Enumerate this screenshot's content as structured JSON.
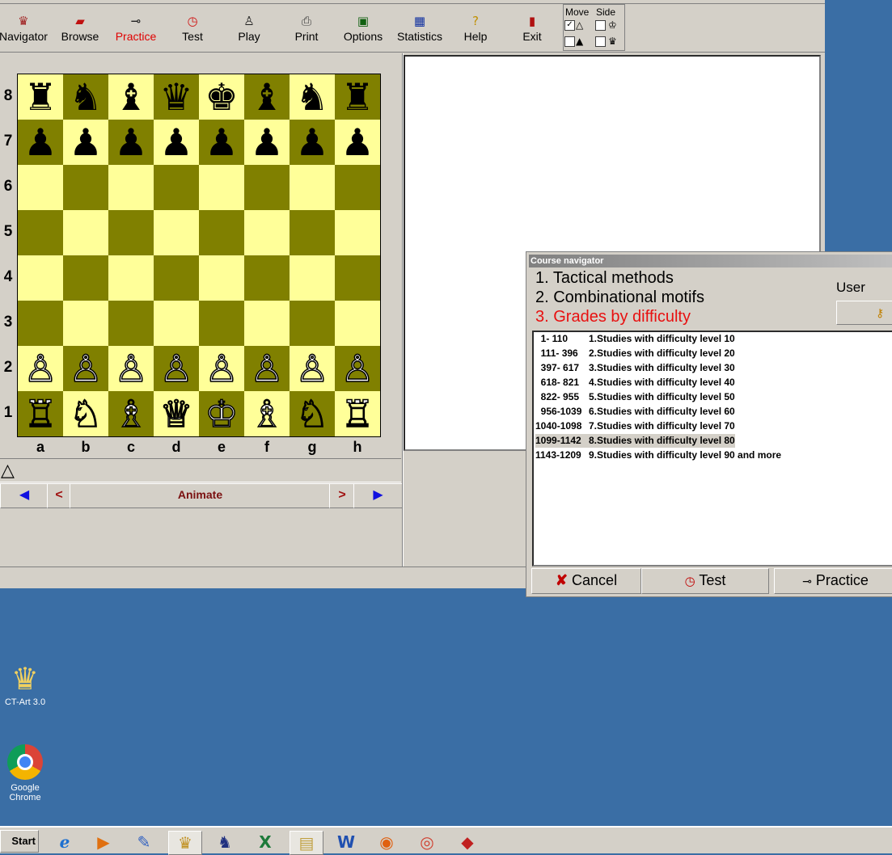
{
  "toolbar": [
    {
      "label": "Navigator",
      "icon": "navigator-icon",
      "glyph": "♛"
    },
    {
      "label": "Browse",
      "icon": "browse-icon",
      "glyph": "▰"
    },
    {
      "label": "Practice",
      "icon": "key-icon",
      "glyph": "⊸",
      "active": true
    },
    {
      "label": "Test",
      "icon": "clock-icon",
      "glyph": "◷"
    },
    {
      "label": "Play",
      "icon": "pawn-icon",
      "glyph": "♙"
    },
    {
      "label": "Print",
      "icon": "printer-icon",
      "glyph": "⎙"
    },
    {
      "label": "Options",
      "icon": "monitor-icon",
      "glyph": "▣"
    },
    {
      "label": "Statistics",
      "icon": "table-icon",
      "glyph": "▦"
    },
    {
      "label": "Help",
      "icon": "help-icon",
      "glyph": "?"
    },
    {
      "label": "Exit",
      "icon": "door-icon",
      "glyph": "▮"
    }
  ],
  "move_side": {
    "move_label": "Move",
    "side_label": "Side",
    "move_white_checked": true,
    "move_black_checked": false,
    "side_white_checked": false,
    "side_black_checked": false
  },
  "board": {
    "ranks": [
      "8",
      "7",
      "6",
      "5",
      "4",
      "3",
      "2",
      "1"
    ],
    "files": [
      "a",
      "b",
      "c",
      "d",
      "e",
      "f",
      "g",
      "h"
    ],
    "position": [
      [
        "♜",
        "♞",
        "♝",
        "♛",
        "♚",
        "♝",
        "♞",
        "♜"
      ],
      [
        "♟",
        "♟",
        "♟",
        "♟",
        "♟",
        "♟",
        "♟",
        "♟"
      ],
      [
        "",
        "",
        "",
        "",
        "",
        "",
        "",
        ""
      ],
      [
        "",
        "",
        "",
        "",
        "",
        "",
        "",
        ""
      ],
      [
        "",
        "",
        "",
        "",
        "",
        "",
        "",
        ""
      ],
      [
        "",
        "",
        "",
        "",
        "",
        "",
        "",
        ""
      ],
      [
        "♙",
        "♙",
        "♙",
        "♙",
        "♙",
        "♙",
        "♙",
        "♙"
      ],
      [
        "♖",
        "♘",
        "♗",
        "♕",
        "♔",
        "♗",
        "♘",
        "♖"
      ]
    ]
  },
  "navigation": {
    "first": "◀",
    "prev": "<",
    "animate": "Animate",
    "next": ">",
    "last": "▶",
    "move_marker": "△"
  },
  "course_navigator": {
    "title": "Course navigator",
    "courses": [
      {
        "label": "1. Tactical methods",
        "color": "#000000"
      },
      {
        "label": "2. Combinational motifs",
        "color": "#000000"
      },
      {
        "label": "3. Grades by difficulty",
        "color": "#e81010"
      }
    ],
    "user_label": "User",
    "rows": [
      {
        "range": "  1- 110",
        "title": "1.Studies with difficulty level 10"
      },
      {
        "range": "  111- 396",
        "title": "2.Studies with difficulty level 20"
      },
      {
        "range": "  397- 617",
        "title": "3.Studies with difficulty level 30"
      },
      {
        "range": "  618- 821",
        "title": "4.Studies with difficulty level 40"
      },
      {
        "range": "  822- 955",
        "title": "5.Studies with difficulty level 50"
      },
      {
        "range": "  956-1039",
        "title": "6.Studies with difficulty level 60"
      },
      {
        "range": "1040-1098",
        "title": "7.Studies with difficulty level 70"
      },
      {
        "range": "1099-1142",
        "title": "8.Studies with difficulty level 80",
        "selected": true
      },
      {
        "range": "1143-1209",
        "title": "9.Studies with difficulty level 90 and more"
      }
    ],
    "buttons": {
      "cancel": "Cancel",
      "test": "Test",
      "practice": "Practice"
    }
  },
  "desktop_icons": [
    {
      "label": "CT-Art 3.0",
      "icon": "ct-art-icon"
    },
    {
      "label": "Google Chrome",
      "icon": "chrome-icon"
    }
  ],
  "taskbar": {
    "start_label": "Start",
    "items": [
      {
        "icon": "ie-icon",
        "glyph": "ℯ"
      },
      {
        "icon": "media-player-icon",
        "glyph": "▶"
      },
      {
        "icon": "tool-icon",
        "glyph": "✎"
      },
      {
        "icon": "ct-art-task-icon",
        "glyph": "♛"
      },
      {
        "icon": "chess-app-icon",
        "glyph": "♞"
      },
      {
        "icon": "excel-icon",
        "glyph": "X"
      },
      {
        "icon": "explorer-icon",
        "glyph": "▤"
      },
      {
        "icon": "word-icon",
        "glyph": "W"
      },
      {
        "icon": "firefox-icon",
        "glyph": "◉"
      },
      {
        "icon": "chrome-task-icon",
        "glyph": "◎"
      },
      {
        "icon": "app-diamond-icon",
        "glyph": "◆"
      }
    ]
  },
  "colors": {
    "board_light": "#ffff99",
    "board_dark": "#808000",
    "desktop": "#3a6ea5",
    "accent_red": "#e81010"
  }
}
